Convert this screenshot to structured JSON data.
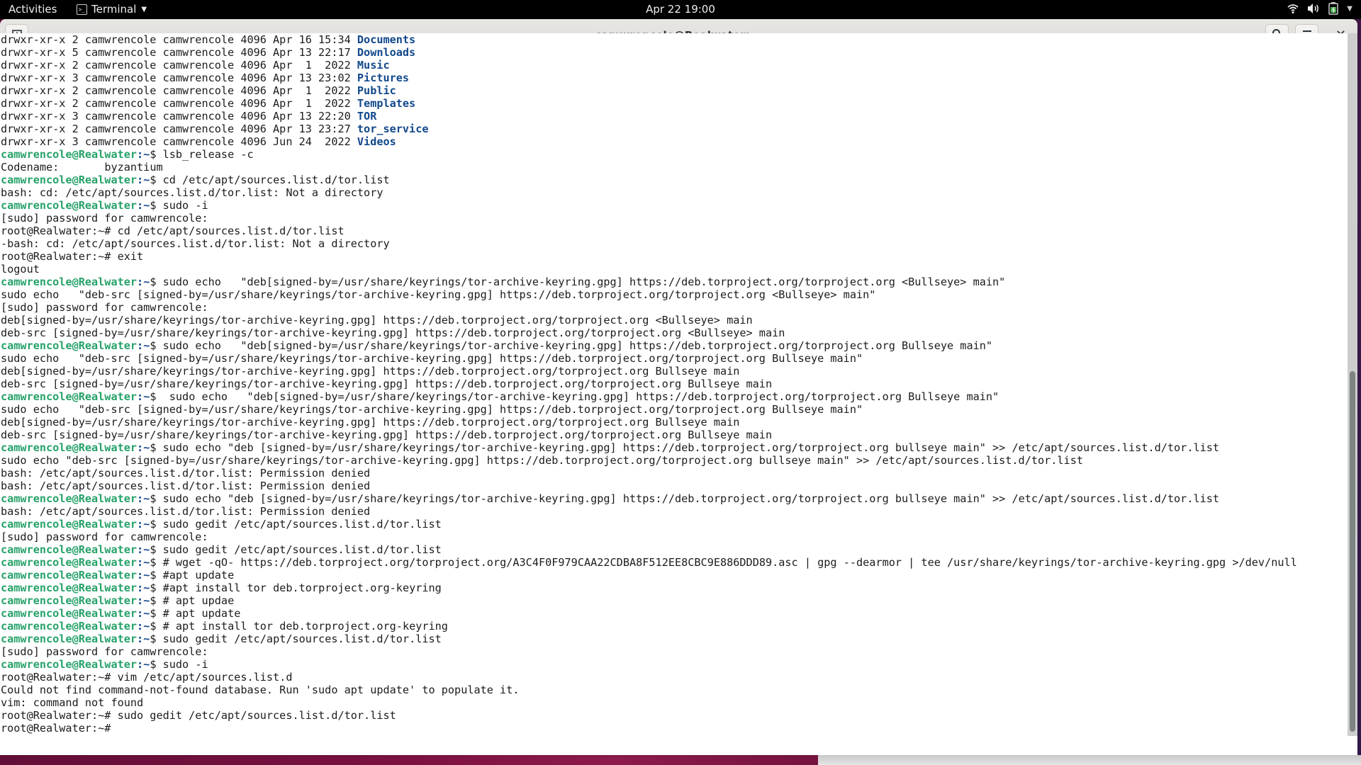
{
  "topbar": {
    "activities": "Activities",
    "app_name": "Terminal",
    "app_icon": "terminal-icon",
    "clock": "Apr 22  19:00",
    "tray_icons": [
      "wifi-icon",
      "volume-icon",
      "battery-icon",
      "system-menu-caret-icon"
    ]
  },
  "window": {
    "title": "camwrencole@Realwater: ~",
    "new_tab_icon": "new-tab-icon",
    "search_icon": "search-icon",
    "menu_icon": "hamburger-menu-icon",
    "close_icon": "close-icon"
  },
  "prompt": {
    "user_host": "camwrencole@Realwater",
    "sep": ":~",
    "dollar": "$"
  },
  "terminal_lines": [
    {
      "type": "ls",
      "text": "drwxr-xr-x 2 camwrencole camwrencole 4096 Apr 16 15:34 ",
      "dir": "Documents"
    },
    {
      "type": "ls",
      "text": "drwxr-xr-x 5 camwrencole camwrencole 4096 Apr 13 22:17 ",
      "dir": "Downloads"
    },
    {
      "type": "ls",
      "text": "drwxr-xr-x 2 camwrencole camwrencole 4096 Apr  1  2022 ",
      "dir": "Music"
    },
    {
      "type": "ls",
      "text": "drwxr-xr-x 3 camwrencole camwrencole 4096 Apr 13 23:02 ",
      "dir": "Pictures"
    },
    {
      "type": "ls",
      "text": "drwxr-xr-x 2 camwrencole camwrencole 4096 Apr  1  2022 ",
      "dir": "Public"
    },
    {
      "type": "ls",
      "text": "drwxr-xr-x 2 camwrencole camwrencole 4096 Apr  1  2022 ",
      "dir": "Templates"
    },
    {
      "type": "ls",
      "text": "drwxr-xr-x 3 camwrencole camwrencole 4096 Apr 13 22:20 ",
      "dir": "TOR"
    },
    {
      "type": "ls",
      "text": "drwxr-xr-x 2 camwrencole camwrencole 4096 Apr 13 23:27 ",
      "dir": "tor_service"
    },
    {
      "type": "ls",
      "text": "drwxr-xr-x 3 camwrencole camwrencole 4096 Jun 24  2022 ",
      "dir": "Videos"
    },
    {
      "type": "cmd",
      "text": " lsb_release -c"
    },
    {
      "type": "out",
      "text": "Codename:\tbyzantium"
    },
    {
      "type": "cmd",
      "text": " cd /etc/apt/sources.list.d/tor.list"
    },
    {
      "type": "out",
      "text": "bash: cd: /etc/apt/sources.list.d/tor.list: Not a directory"
    },
    {
      "type": "cmd",
      "text": " sudo -i"
    },
    {
      "type": "out",
      "text": "[sudo] password for camwrencole:"
    },
    {
      "type": "out",
      "text": "root@Realwater:~# cd /etc/apt/sources.list.d/tor.list"
    },
    {
      "type": "out",
      "text": "-bash: cd: /etc/apt/sources.list.d/tor.list: Not a directory"
    },
    {
      "type": "out",
      "text": "root@Realwater:~# exit"
    },
    {
      "type": "out",
      "text": "logout"
    },
    {
      "type": "cmd",
      "text": " sudo echo   \"deb[signed-by=/usr/share/keyrings/tor-archive-keyring.gpg] https://deb.torproject.org/torproject.org <Bullseye> main\""
    },
    {
      "type": "out",
      "text": "sudo echo   \"deb-src [signed-by=/usr/share/keyrings/tor-archive-keyring.gpg] https://deb.torproject.org/torproject.org <Bullseye> main\""
    },
    {
      "type": "out",
      "text": "[sudo] password for camwrencole:"
    },
    {
      "type": "out",
      "text": "deb[signed-by=/usr/share/keyrings/tor-archive-keyring.gpg] https://deb.torproject.org/torproject.org <Bullseye> main"
    },
    {
      "type": "out",
      "text": "deb-src [signed-by=/usr/share/keyrings/tor-archive-keyring.gpg] https://deb.torproject.org/torproject.org <Bullseye> main"
    },
    {
      "type": "cmd",
      "text": " sudo echo   \"deb[signed-by=/usr/share/keyrings/tor-archive-keyring.gpg] https://deb.torproject.org/torproject.org Bullseye main\""
    },
    {
      "type": "out",
      "text": "sudo echo   \"deb-src [signed-by=/usr/share/keyrings/tor-archive-keyring.gpg] https://deb.torproject.org/torproject.org Bullseye main\""
    },
    {
      "type": "out",
      "text": "deb[signed-by=/usr/share/keyrings/tor-archive-keyring.gpg] https://deb.torproject.org/torproject.org Bullseye main"
    },
    {
      "type": "out",
      "text": "deb-src [signed-by=/usr/share/keyrings/tor-archive-keyring.gpg] https://deb.torproject.org/torproject.org Bullseye main"
    },
    {
      "type": "cmd",
      "text": "  sudo echo   \"deb[signed-by=/usr/share/keyrings/tor-archive-keyring.gpg] https://deb.torproject.org/torproject.org Bullseye main\""
    },
    {
      "type": "out",
      "text": "sudo echo   \"deb-src [signed-by=/usr/share/keyrings/tor-archive-keyring.gpg] https://deb.torproject.org/torproject.org Bullseye main\""
    },
    {
      "type": "out",
      "text": "deb[signed-by=/usr/share/keyrings/tor-archive-keyring.gpg] https://deb.torproject.org/torproject.org Bullseye main"
    },
    {
      "type": "out",
      "text": "deb-src [signed-by=/usr/share/keyrings/tor-archive-keyring.gpg] https://deb.torproject.org/torproject.org Bullseye main"
    },
    {
      "type": "cmd",
      "text": " sudo echo \"deb [signed-by=/usr/share/keyrings/tor-archive-keyring.gpg] https://deb.torproject.org/torproject.org bullseye main\" >> /etc/apt/sources.list.d/tor.list"
    },
    {
      "type": "out",
      "text": "sudo echo \"deb-src [signed-by=/usr/share/keyrings/tor-archive-keyring.gpg] https://deb.torproject.org/torproject.org bullseye main\" >> /etc/apt/sources.list.d/tor.list"
    },
    {
      "type": "out",
      "text": "bash: /etc/apt/sources.list.d/tor.list: Permission denied"
    },
    {
      "type": "out",
      "text": "bash: /etc/apt/sources.list.d/tor.list: Permission denied"
    },
    {
      "type": "cmd",
      "text": " sudo echo \"deb [signed-by=/usr/share/keyrings/tor-archive-keyring.gpg] https://deb.torproject.org/torproject.org bullseye main\" >> /etc/apt/sources.list.d/tor.list"
    },
    {
      "type": "out",
      "text": "bash: /etc/apt/sources.list.d/tor.list: Permission denied"
    },
    {
      "type": "cmd",
      "text": " sudo gedit /etc/apt/sources.list.d/tor.list"
    },
    {
      "type": "out",
      "text": "[sudo] password for camwrencole:"
    },
    {
      "type": "cmd",
      "text": " sudo gedit /etc/apt/sources.list.d/tor.list"
    },
    {
      "type": "cmd",
      "text": " # wget -qO- https://deb.torproject.org/torproject.org/A3C4F0F979CAA22CDBA8F512EE8CBC9E886DDD89.asc | gpg --dearmor | tee /usr/share/keyrings/tor-archive-keyring.gpg >/dev/null"
    },
    {
      "type": "cmd",
      "text": " #apt update"
    },
    {
      "type": "cmd",
      "text": " #apt install tor deb.torproject.org-keyring"
    },
    {
      "type": "cmd",
      "text": " # apt updae"
    },
    {
      "type": "cmd",
      "text": " # apt update"
    },
    {
      "type": "cmd",
      "text": " # apt install tor deb.torproject.org-keyring"
    },
    {
      "type": "cmd",
      "text": " sudo gedit /etc/apt/sources.list.d/tor.list"
    },
    {
      "type": "out",
      "text": "[sudo] password for camwrencole:"
    },
    {
      "type": "cmd",
      "text": " sudo -i"
    },
    {
      "type": "out",
      "text": "root@Realwater:~# vim /etc/apt/sources.list.d"
    },
    {
      "type": "out",
      "text": "Could not find command-not-found database. Run 'sudo apt update' to populate it."
    },
    {
      "type": "out",
      "text": "vim: command not found"
    },
    {
      "type": "out",
      "text": "root@Realwater:~# sudo gedit /etc/apt/sources.list.d/tor.list"
    },
    {
      "type": "out",
      "text": "root@Realwater:~# "
    }
  ],
  "scrollbar": {
    "position_fraction": 1.0,
    "visible_fraction": 0.51
  }
}
